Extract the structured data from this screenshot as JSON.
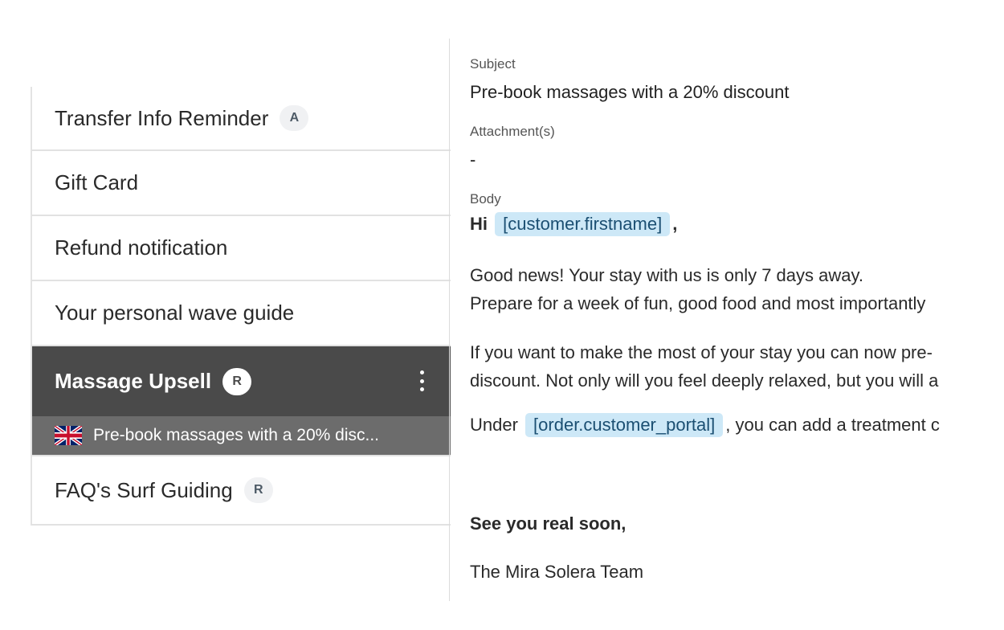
{
  "templates": {
    "items": [
      {
        "label": "Transfer Info Reminder",
        "badge": "A"
      },
      {
        "label": "Gift Card",
        "badge": ""
      },
      {
        "label": "Refund notification",
        "badge": ""
      },
      {
        "label": "Your personal wave guide",
        "badge": ""
      },
      {
        "label": "Massage Upsell",
        "badge": "R",
        "selected": true
      },
      {
        "label": "FAQ's Surf Guiding",
        "badge": "R"
      }
    ],
    "selected_sub": {
      "flag_icon": "uk-flag-icon",
      "text": "Pre-book massages with a 20% disc..."
    },
    "menu_icon": "kebab-menu-icon"
  },
  "detail": {
    "subject_label": "Subject",
    "subject_value": "Pre-book massages with a 20% discount",
    "attachments_label": "Attachment(s)",
    "attachments_value": "-",
    "body_label": "Body",
    "body": {
      "greeting": "Hi",
      "greeting_token": "[customer.firstname]",
      "greeting_suffix": ",",
      "line1": "Good news! Your stay with us is only 7 days away.",
      "line2": "Prepare for a week of fun, good food and most importantly",
      "line3": "If you want to make the most of your stay you can now pre-",
      "line4": "discount. Not only will you feel deeply relaxed, but you will a",
      "line5_prefix": "Under",
      "line5_token": "[order.customer_portal]",
      "line5_suffix": ", you can add a treatment c",
      "closing": "See you real soon,",
      "signature": "The Mira Solera Team"
    }
  },
  "colors": {
    "selected_bg": "#4a4a4a",
    "sub_bg": "#6c6c6c",
    "token_bg": "#cde8f7",
    "badge_bg": "#f0f1f3"
  }
}
